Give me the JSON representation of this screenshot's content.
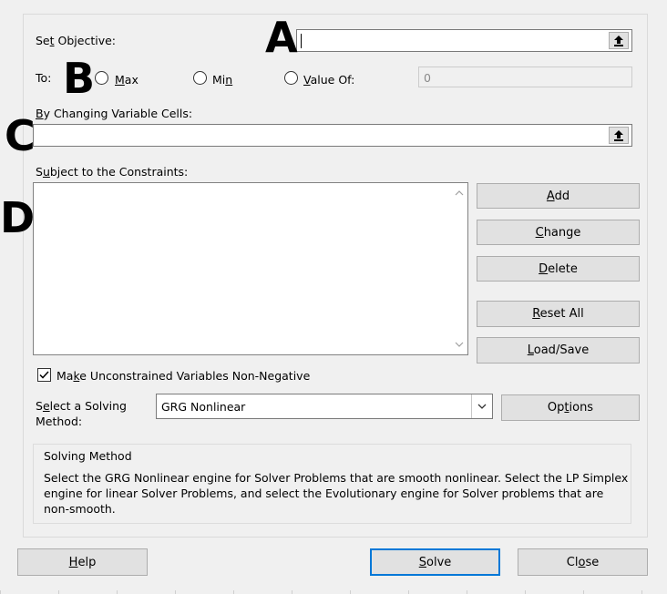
{
  "objective": {
    "label_pre": "Se",
    "label_key": "t",
    "label_post": " Objective:",
    "value": ""
  },
  "to": {
    "label": "To:",
    "max": {
      "key": "M",
      "rest": "ax"
    },
    "min": {
      "pre": "Mi",
      "key": "n"
    },
    "value_of": {
      "key": "V",
      "rest": "alue Of:",
      "value": "0"
    }
  },
  "variables": {
    "label_key": "B",
    "label_rest": "y Changing Variable Cells:",
    "value": ""
  },
  "constraints": {
    "label_pre": "S",
    "label_key": "u",
    "label_post": "bject to the Constraints:"
  },
  "buttons": {
    "add": {
      "key": "A",
      "rest": "dd"
    },
    "change": {
      "key": "C",
      "rest": "hange"
    },
    "delete": {
      "key": "D",
      "rest": "elete"
    },
    "reset_all": {
      "key": "R",
      "rest": "eset All"
    },
    "load_save": {
      "key": "L",
      "rest": "oad/Save"
    },
    "options": {
      "pre": "Op",
      "key": "t",
      "post": "ions"
    },
    "help": {
      "key": "H",
      "rest": "elp"
    },
    "solve": {
      "key": "S",
      "rest": "olve"
    },
    "close": {
      "pre": "Cl",
      "key": "o",
      "post": "se"
    }
  },
  "nonneg": {
    "checked": true,
    "pre": "Ma",
    "key": "k",
    "post": "e Unconstrained Variables Non-Negative"
  },
  "method": {
    "label_pre": "S",
    "label_key": "e",
    "label_post": "lect a Solving",
    "label_line2": "Method:",
    "selected": "GRG Nonlinear"
  },
  "description": {
    "title": "Solving Method",
    "line1": "Select the GRG Nonlinear engine for Solver Problems that are smooth nonlinear. Select the LP Simplex",
    "line2": "engine for linear Solver Problems, and select the Evolutionary engine for Solver problems that are",
    "line3": "non-smooth."
  },
  "annotations": {
    "a": "A",
    "b": "B",
    "c": "C",
    "d": "D"
  }
}
